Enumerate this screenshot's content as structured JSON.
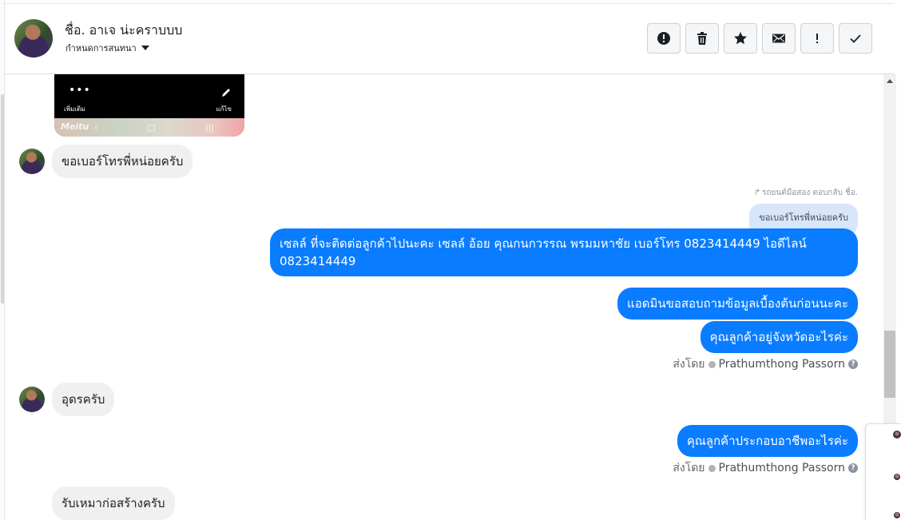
{
  "header": {
    "contact_name": "ชื่อ. อาเจ น่ะคราบบบ",
    "subtitle": "กำหนดการสนทนา",
    "actions": [
      {
        "name": "report-button",
        "icon": "alert-circle-icon",
        "glyph": "!"
      },
      {
        "name": "delete-button",
        "icon": "trash-icon",
        "glyph": ""
      },
      {
        "name": "star-button",
        "icon": "star-icon",
        "glyph": "★"
      },
      {
        "name": "mail-button",
        "icon": "envelope-icon",
        "glyph": ""
      },
      {
        "name": "important-button",
        "icon": "exclamation-icon",
        "glyph": "!"
      },
      {
        "name": "done-button",
        "icon": "check-icon",
        "glyph": "✓"
      }
    ]
  },
  "image_message": {
    "more_label": "เพิ่มเติม",
    "edit_label": "แก้ไข",
    "brand": "Meitu"
  },
  "messages": {
    "m1": "ขอเบอร์โทรพี่หน่อยครับ",
    "reply_meta": "รถยนต์มือสอง ตอบกลับ ชื่อ.",
    "reply_quote": "ขอเบอร์โทรพี่หน่อยครับ",
    "m2": "เซลล์ ที่จะติดต่อลูกค้าไปนะคะ เซลล์ อ้อย คุณกนกวรรณ พรมมหาชัย เบอร์โทร 0823414449 ไอดีไลน์ 0823414449",
    "m3": "แอดมินขอสอบถามข้อมูลเบื้องต้นก่อนนะคะ",
    "m4": "คุณลูกค้าอยู่จังหวัดอะไรค่ะ",
    "m5": "อุดรครับ",
    "m6": "คุณลูกค้าประกอบอาชีพอะไรค่ะ",
    "m7": "รับเหมาก่อสร้างครับ"
  },
  "sent_by": {
    "prefix": "ส่งโดย",
    "agent": "Prathumthong Passorn",
    "help": "?"
  },
  "colors": {
    "outgoing": "#0a7cff",
    "incoming": "#f1f0f0",
    "quote": "#d8e6fb"
  }
}
